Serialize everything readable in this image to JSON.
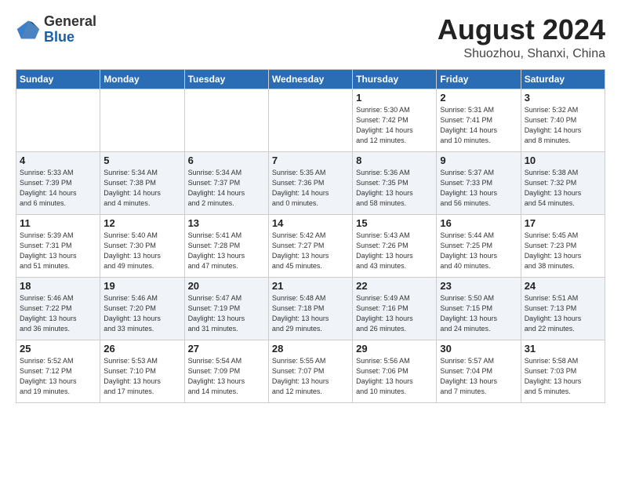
{
  "header": {
    "logo_general": "General",
    "logo_blue": "Blue",
    "month_title": "August 2024",
    "location": "Shuozhou, Shanxi, China"
  },
  "days_of_week": [
    "Sunday",
    "Monday",
    "Tuesday",
    "Wednesday",
    "Thursday",
    "Friday",
    "Saturday"
  ],
  "weeks": [
    [
      {
        "day": "",
        "info": ""
      },
      {
        "day": "",
        "info": ""
      },
      {
        "day": "",
        "info": ""
      },
      {
        "day": "",
        "info": ""
      },
      {
        "day": "1",
        "info": "Sunrise: 5:30 AM\nSunset: 7:42 PM\nDaylight: 14 hours\nand 12 minutes."
      },
      {
        "day": "2",
        "info": "Sunrise: 5:31 AM\nSunset: 7:41 PM\nDaylight: 14 hours\nand 10 minutes."
      },
      {
        "day": "3",
        "info": "Sunrise: 5:32 AM\nSunset: 7:40 PM\nDaylight: 14 hours\nand 8 minutes."
      }
    ],
    [
      {
        "day": "4",
        "info": "Sunrise: 5:33 AM\nSunset: 7:39 PM\nDaylight: 14 hours\nand 6 minutes."
      },
      {
        "day": "5",
        "info": "Sunrise: 5:34 AM\nSunset: 7:38 PM\nDaylight: 14 hours\nand 4 minutes."
      },
      {
        "day": "6",
        "info": "Sunrise: 5:34 AM\nSunset: 7:37 PM\nDaylight: 14 hours\nand 2 minutes."
      },
      {
        "day": "7",
        "info": "Sunrise: 5:35 AM\nSunset: 7:36 PM\nDaylight: 14 hours\nand 0 minutes."
      },
      {
        "day": "8",
        "info": "Sunrise: 5:36 AM\nSunset: 7:35 PM\nDaylight: 13 hours\nand 58 minutes."
      },
      {
        "day": "9",
        "info": "Sunrise: 5:37 AM\nSunset: 7:33 PM\nDaylight: 13 hours\nand 56 minutes."
      },
      {
        "day": "10",
        "info": "Sunrise: 5:38 AM\nSunset: 7:32 PM\nDaylight: 13 hours\nand 54 minutes."
      }
    ],
    [
      {
        "day": "11",
        "info": "Sunrise: 5:39 AM\nSunset: 7:31 PM\nDaylight: 13 hours\nand 51 minutes."
      },
      {
        "day": "12",
        "info": "Sunrise: 5:40 AM\nSunset: 7:30 PM\nDaylight: 13 hours\nand 49 minutes."
      },
      {
        "day": "13",
        "info": "Sunrise: 5:41 AM\nSunset: 7:28 PM\nDaylight: 13 hours\nand 47 minutes."
      },
      {
        "day": "14",
        "info": "Sunrise: 5:42 AM\nSunset: 7:27 PM\nDaylight: 13 hours\nand 45 minutes."
      },
      {
        "day": "15",
        "info": "Sunrise: 5:43 AM\nSunset: 7:26 PM\nDaylight: 13 hours\nand 43 minutes."
      },
      {
        "day": "16",
        "info": "Sunrise: 5:44 AM\nSunset: 7:25 PM\nDaylight: 13 hours\nand 40 minutes."
      },
      {
        "day": "17",
        "info": "Sunrise: 5:45 AM\nSunset: 7:23 PM\nDaylight: 13 hours\nand 38 minutes."
      }
    ],
    [
      {
        "day": "18",
        "info": "Sunrise: 5:46 AM\nSunset: 7:22 PM\nDaylight: 13 hours\nand 36 minutes."
      },
      {
        "day": "19",
        "info": "Sunrise: 5:46 AM\nSunset: 7:20 PM\nDaylight: 13 hours\nand 33 minutes."
      },
      {
        "day": "20",
        "info": "Sunrise: 5:47 AM\nSunset: 7:19 PM\nDaylight: 13 hours\nand 31 minutes."
      },
      {
        "day": "21",
        "info": "Sunrise: 5:48 AM\nSunset: 7:18 PM\nDaylight: 13 hours\nand 29 minutes."
      },
      {
        "day": "22",
        "info": "Sunrise: 5:49 AM\nSunset: 7:16 PM\nDaylight: 13 hours\nand 26 minutes."
      },
      {
        "day": "23",
        "info": "Sunrise: 5:50 AM\nSunset: 7:15 PM\nDaylight: 13 hours\nand 24 minutes."
      },
      {
        "day": "24",
        "info": "Sunrise: 5:51 AM\nSunset: 7:13 PM\nDaylight: 13 hours\nand 22 minutes."
      }
    ],
    [
      {
        "day": "25",
        "info": "Sunrise: 5:52 AM\nSunset: 7:12 PM\nDaylight: 13 hours\nand 19 minutes."
      },
      {
        "day": "26",
        "info": "Sunrise: 5:53 AM\nSunset: 7:10 PM\nDaylight: 13 hours\nand 17 minutes."
      },
      {
        "day": "27",
        "info": "Sunrise: 5:54 AM\nSunset: 7:09 PM\nDaylight: 13 hours\nand 14 minutes."
      },
      {
        "day": "28",
        "info": "Sunrise: 5:55 AM\nSunset: 7:07 PM\nDaylight: 13 hours\nand 12 minutes."
      },
      {
        "day": "29",
        "info": "Sunrise: 5:56 AM\nSunset: 7:06 PM\nDaylight: 13 hours\nand 10 minutes."
      },
      {
        "day": "30",
        "info": "Sunrise: 5:57 AM\nSunset: 7:04 PM\nDaylight: 13 hours\nand 7 minutes."
      },
      {
        "day": "31",
        "info": "Sunrise: 5:58 AM\nSunset: 7:03 PM\nDaylight: 13 hours\nand 5 minutes."
      }
    ]
  ]
}
